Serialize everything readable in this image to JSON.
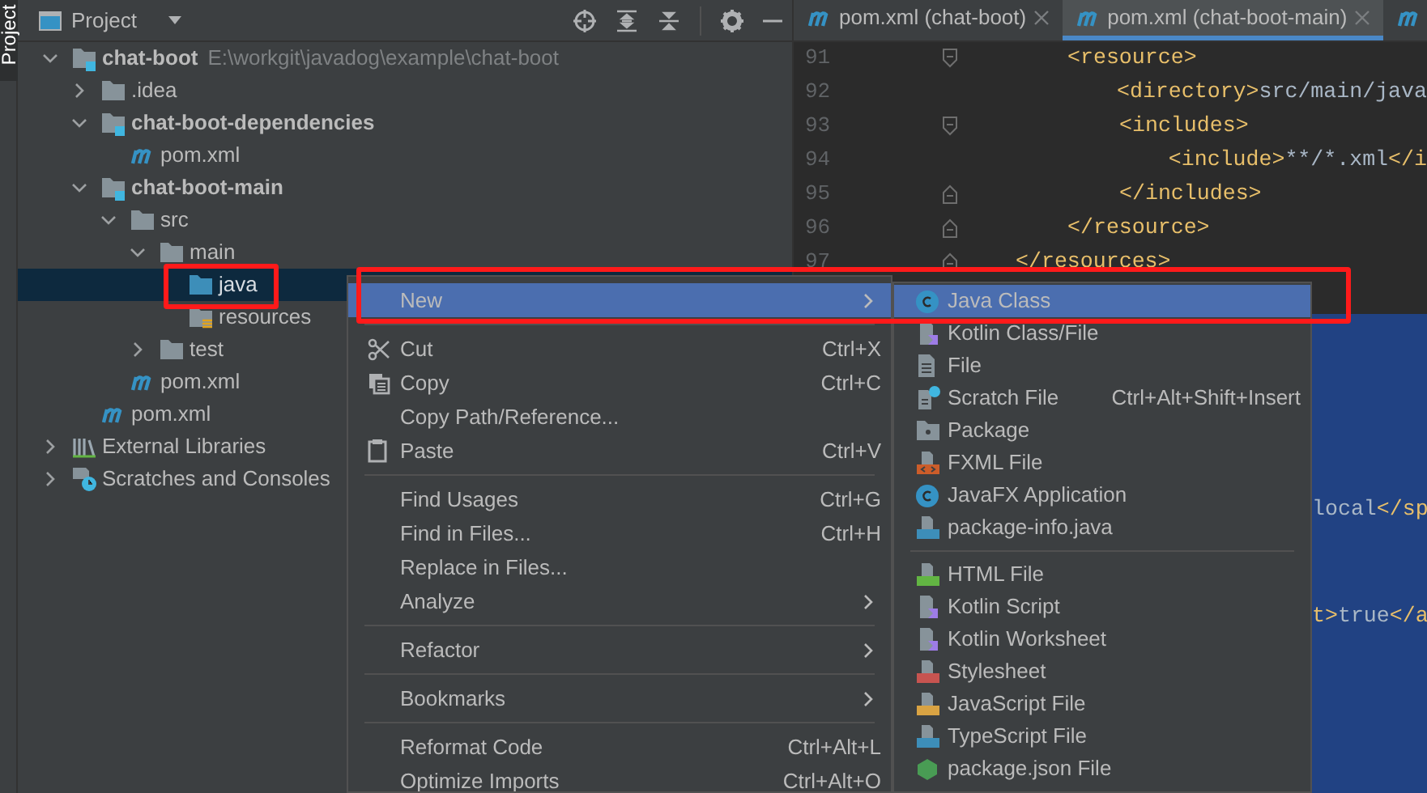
{
  "tool_stripe": {
    "label": "Project"
  },
  "project_panel": {
    "title": "Project",
    "tree": [
      {
        "label": "chat-boot",
        "kind": "module",
        "bold": true,
        "hint": "E:\\workgit\\javadog\\example\\chat-boot",
        "expanded": true,
        "selected": false,
        "children": [
          {
            "label": ".idea",
            "kind": "folder",
            "bold": false,
            "expanded": false,
            "selected": false
          },
          {
            "label": "chat-boot-dependencies",
            "kind": "module",
            "bold": true,
            "expanded": true,
            "selected": false,
            "children": [
              {
                "label": "pom.xml",
                "kind": "maven",
                "bold": false,
                "selected": false
              }
            ]
          },
          {
            "label": "chat-boot-main",
            "kind": "module",
            "bold": true,
            "expanded": true,
            "selected": false,
            "children": [
              {
                "label": "src",
                "kind": "folder",
                "bold": false,
                "expanded": true,
                "selected": false,
                "children": [
                  {
                    "label": "main",
                    "kind": "folder",
                    "bold": false,
                    "expanded": true,
                    "selected": false,
                    "children": [
                      {
                        "label": "java",
                        "kind": "source",
                        "bold": false,
                        "selected": true
                      },
                      {
                        "label": "resources",
                        "kind": "resources",
                        "bold": false,
                        "selected": false
                      }
                    ]
                  },
                  {
                    "label": "test",
                    "kind": "folder",
                    "bold": false,
                    "expanded": false,
                    "selected": false
                  }
                ]
              },
              {
                "label": "pom.xml",
                "kind": "maven",
                "bold": false,
                "selected": false
              }
            ]
          },
          {
            "label": "pom.xml",
            "kind": "maven",
            "bold": false,
            "selected": false
          }
        ]
      },
      {
        "label": "External Libraries",
        "kind": "libraries",
        "bold": false,
        "expanded": false,
        "selected": false
      },
      {
        "label": "Scratches and Consoles",
        "kind": "scratches",
        "bold": false,
        "expanded": false,
        "selected": false
      }
    ]
  },
  "editor": {
    "tabs": [
      {
        "label": "pom.xml (chat-boot)",
        "selected": false
      },
      {
        "label": "pom.xml (chat-boot-main)",
        "selected": true
      },
      {
        "selected": false
      }
    ],
    "lines": [
      {
        "number": "91",
        "kind": "open",
        "segments": [
          {
            "kind": "tag",
            "text": "<resource>"
          }
        ]
      },
      {
        "number": "92",
        "kind": "plain",
        "segments": [
          {
            "kind": "tag",
            "text": "<directory>"
          },
          {
            "kind": "text",
            "text": "src/main/java"
          }
        ]
      },
      {
        "number": "93",
        "kind": "open",
        "segments": [
          {
            "kind": "tag",
            "text": "<includes>"
          }
        ]
      },
      {
        "number": "94",
        "kind": "plain",
        "segments": [
          {
            "kind": "tag",
            "text": "<include>"
          },
          {
            "kind": "text",
            "text": "**/*.xml"
          },
          {
            "kind": "tag",
            "text": "</i"
          }
        ]
      },
      {
        "number": "95",
        "kind": "close",
        "segments": [
          {
            "kind": "tag",
            "text": "</includes>"
          }
        ]
      },
      {
        "number": "96",
        "kind": "close",
        "segments": [
          {
            "kind": "tag",
            "text": "</resource>"
          }
        ]
      },
      {
        "number": "97",
        "kind": "close",
        "segments": [
          {
            "kind": "tag",
            "text": "</resources>"
          }
        ]
      }
    ],
    "selected_fragments": [
      [
        {
          "kind": "text",
          "text": "local"
        },
        {
          "kind": "tag",
          "text": "</sp"
        }
      ],
      [
        {
          "kind": "tag",
          "text": "t>"
        },
        {
          "kind": "text",
          "text": "true"
        },
        {
          "kind": "tag",
          "text": "</a"
        }
      ]
    ]
  },
  "context_menu": {
    "sections": [
      [
        {
          "label": "New",
          "submenu": true,
          "selected": true
        }
      ],
      [
        {
          "label": "Cut",
          "kind": "cut",
          "shortcut": "Ctrl+X",
          "selected": false
        },
        {
          "label": "Copy",
          "kind": "copy",
          "shortcut": "Ctrl+C",
          "selected": false
        },
        {
          "label": "Copy Path/Reference...",
          "selected": false
        },
        {
          "label": "Paste",
          "kind": "paste",
          "shortcut": "Ctrl+V",
          "selected": false
        }
      ],
      [
        {
          "label": "Find Usages",
          "shortcut": "Ctrl+G",
          "selected": false
        },
        {
          "label": "Find in Files...",
          "shortcut": "Ctrl+H",
          "selected": false
        },
        {
          "label": "Replace in Files...",
          "selected": false
        },
        {
          "label": "Analyze",
          "submenu": true,
          "selected": false
        }
      ],
      [
        {
          "label": "Refactor",
          "submenu": true,
          "selected": false
        }
      ],
      [
        {
          "label": "Bookmarks",
          "submenu": true,
          "selected": false
        }
      ],
      [
        {
          "label": "Reformat Code",
          "shortcut": "Ctrl+Alt+L",
          "selected": false
        },
        {
          "label": "Optimize Imports",
          "shortcut": "Ctrl+Alt+O",
          "selected": false
        }
      ]
    ]
  },
  "new_submenu": {
    "sections": [
      [
        {
          "label": "Java Class",
          "kind": "class",
          "selected": true
        },
        {
          "label": "Kotlin Class/File",
          "kind": "kotlin",
          "selected": false
        },
        {
          "label": "File",
          "kind": "file",
          "selected": false
        },
        {
          "label": "Scratch File",
          "kind": "scratch",
          "shortcut": "Ctrl+Alt+Shift+Insert",
          "selected": false
        },
        {
          "label": "Package",
          "kind": "package",
          "selected": false
        },
        {
          "label": "FXML File",
          "kind": "fxml",
          "selected": false
        },
        {
          "label": "JavaFX Application",
          "kind": "class",
          "selected": false
        },
        {
          "label": "package-info.java",
          "kind": "javafile",
          "selected": false
        }
      ],
      [
        {
          "label": "HTML File",
          "kind": "html",
          "selected": false
        },
        {
          "label": "Kotlin Script",
          "kind": "kotlin",
          "selected": false
        },
        {
          "label": "Kotlin Worksheet",
          "kind": "kotlin",
          "selected": false
        },
        {
          "label": "Stylesheet",
          "kind": "css",
          "selected": false
        },
        {
          "label": "JavaScript File",
          "kind": "js",
          "selected": false
        },
        {
          "label": "TypeScript File",
          "kind": "ts",
          "selected": false
        },
        {
          "label": "package.json File",
          "kind": "node",
          "selected": false
        }
      ]
    ]
  },
  "annotation_frames": [
    {
      "kind": "rectangle"
    },
    {
      "kind": "rectangle"
    }
  ]
}
